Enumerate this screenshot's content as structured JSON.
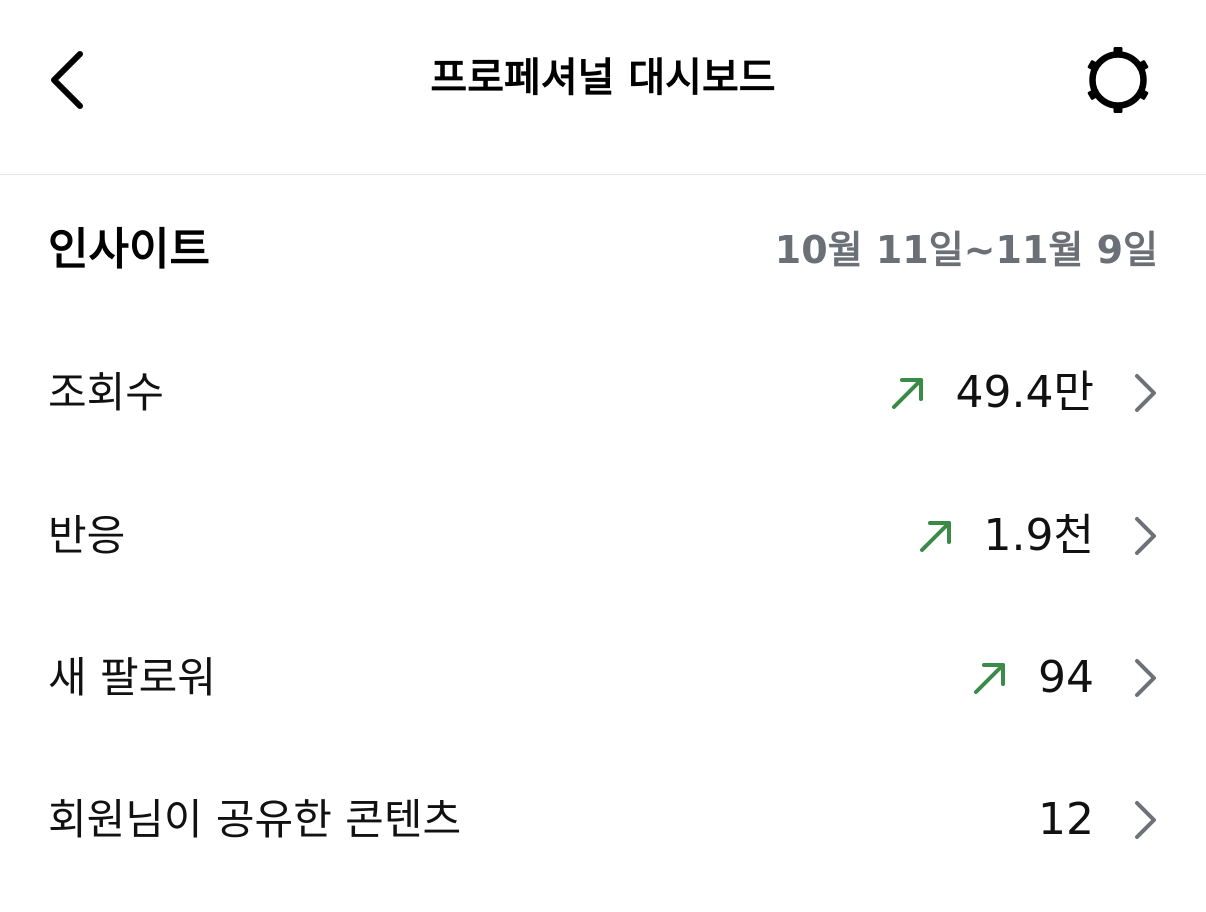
{
  "header": {
    "title": "프로페셔널 대시보드",
    "back_icon": "chevron-left-icon",
    "settings_icon": "gear-icon"
  },
  "insights": {
    "title": "인사이트",
    "date_range": "10월 11일~11월 9일"
  },
  "metrics": [
    {
      "label": "조회수",
      "value": "49.4만",
      "trend": "up",
      "trend_icon": "arrow-up-right-icon"
    },
    {
      "label": "반응",
      "value": "1.9천",
      "trend": "up",
      "trend_icon": "arrow-up-right-icon"
    },
    {
      "label": "새 팔로워",
      "value": "94",
      "trend": "up",
      "trend_icon": "arrow-up-right-icon"
    },
    {
      "label": "회원님이 공유한 콘텐츠",
      "value": "12",
      "trend": "none"
    }
  ],
  "colors": {
    "trend_up": "#3a8a48",
    "muted_text": "#6b6f76",
    "chevron": "#6e7177",
    "divider": "#e6e6e6"
  }
}
